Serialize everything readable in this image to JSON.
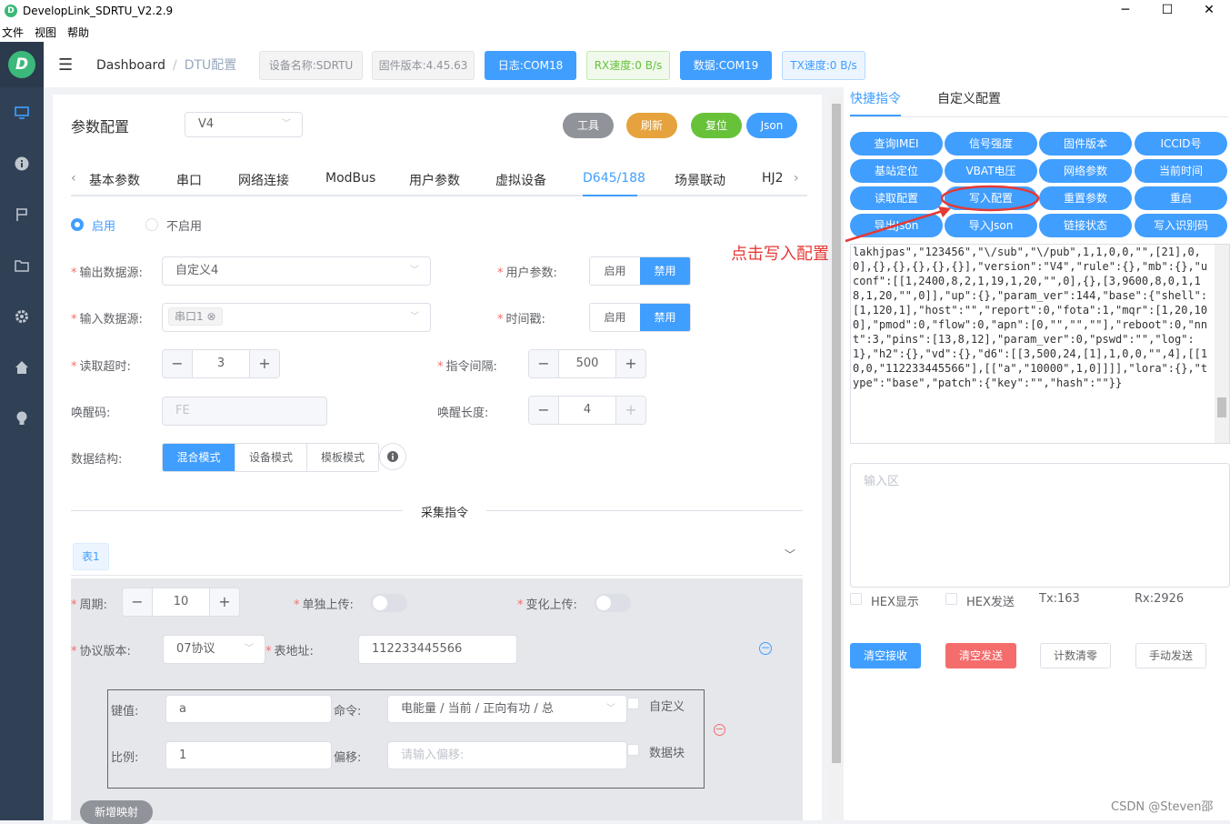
{
  "window": {
    "title": "DevelopLink_SDRTU_V2.2.9",
    "minimize": "─",
    "maximize": "☐",
    "close": "✕"
  },
  "menu": [
    "文件",
    "视图",
    "帮助"
  ],
  "logo_letter": "D",
  "header": {
    "breadcrumb_home": "Dashboard",
    "breadcrumb_sep": "/",
    "breadcrumb_current": "DTU配置",
    "device_name": "设备名称:SDRTU",
    "firmware": "固件版本:4.45.63",
    "log_port": "日志:COM18",
    "rx_speed": "RX速度:0 B/s",
    "data_port": "数据:COM19",
    "tx_speed": "TX速度:0 B/s"
  },
  "config": {
    "title": "参数配置",
    "version": "V4",
    "buttons": {
      "tools": "工具",
      "refresh": "刷新",
      "reset": "复位",
      "json": "Json"
    },
    "tabs": [
      "基本参数",
      "串口",
      "网络连接",
      "ModBus",
      "用户参数",
      "虚拟设备",
      "D645/188",
      "场景联动",
      "HJ2"
    ],
    "active_tab": "D645/188",
    "enable_on": "启用",
    "enable_off": "不启用",
    "output_source_label": "输出数据源:",
    "output_source": "自定义4",
    "user_param_label": "用户参数:",
    "enable": "启用",
    "disable": "禁用",
    "input_source_label": "输入数据源:",
    "input_source_tag": "串口1",
    "timestamp_label": "时间戳:",
    "read_timeout_label": "读取超时:",
    "read_timeout": "3",
    "cmd_interval_label": "指令间隔:",
    "cmd_interval": "500",
    "wake_code_label": "唤醒码:",
    "wake_code": "FE",
    "wake_len_label": "唤醒长度:",
    "wake_len": "4",
    "data_struct_label": "数据结构:",
    "modes": [
      "混合模式",
      "设备模式",
      "模板模式"
    ],
    "collect_title": "采集指令",
    "table_tab": "表1",
    "period_label": "周期:",
    "period": "10",
    "single_upload_label": "单独上传:",
    "change_upload_label": "变化上传:",
    "proto_label": "协议版本:",
    "proto": "07协议",
    "meter_addr_label": "表地址:",
    "meter_addr": "112233445566",
    "key_label": "键值:",
    "key": "a",
    "cmd_label": "命令:",
    "cmd": "电能量 / 当前 / 正向有功 / 总",
    "custom_label": "自定义",
    "ratio_label": "比例:",
    "ratio": "1",
    "offset_label": "偏移:",
    "offset_placeholder": "请输入偏移:",
    "block_label": "数据块",
    "add_mapping": "新增映射"
  },
  "right": {
    "tabs": [
      "快捷指令",
      "自定义配置"
    ],
    "quick_buttons": [
      "查询IMEI",
      "信号强度",
      "固件版本",
      "ICCID号",
      "基站定位",
      "VBAT电压",
      "网络参数",
      "当前时间",
      "读取配置",
      "写入配置",
      "重置参数",
      "重启",
      "导出Json",
      "导入Json",
      "链接状态",
      "写入识别码"
    ],
    "output_text": "lakhjpas\",\"123456\",\"\\/sub\",\"\\/pub\",1,1,0,0,\"\",[21],0,0],{},{},{},{},{}],\"version\":\"V4\",\"rule\":{},\"mb\":{},\"uconf\":[[1,2400,8,2,1,19,1,20,\"\",0],{},[3,9600,8,0,1,18,1,20,\"\",0]],\"up\":{},\"param_ver\":144,\"base\":{\"shell\":[1,120,1],\"host\":\"\",\"report\":0,\"fota\":1,\"mqr\":[1,20,100],\"pmod\":0,\"flow\":0,\"apn\":[0,\"\",\"\",\"\"],\"reboot\":0,\"nnt\":3,\"pins\":[13,8,12],\"param_ver\":0,\"pswd\":\"\",\"log\":1},\"h2\":{},\"vd\":{},\"d6\":[[3,500,24,[1],1,0,0,\"\",4],[[10,0,\"112233445566\"],[[\"a\",\"10000\",1,0]]]],\"lora\":{},\"type\":\"base\",\"patch\":{\"key\":\"\",\"hash\":\"\"}}",
    "input_placeholder": "输入区",
    "hex_show": "HEX显示",
    "hex_send": "HEX发送",
    "tx": "Tx:163",
    "rx": "Rx:2926",
    "clear_rx": "清空接收",
    "clear_tx": "清空发送",
    "clear_count": "计数清零",
    "manual_send": "手动发送"
  },
  "annotation": "点击写入配置",
  "watermark": "CSDN @Steven邵"
}
